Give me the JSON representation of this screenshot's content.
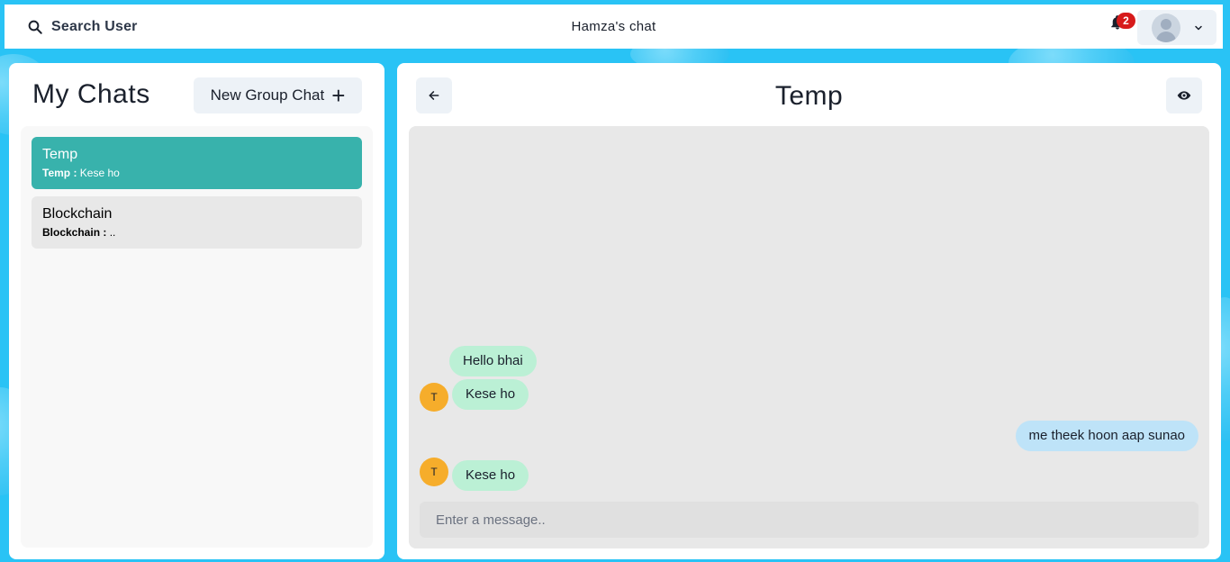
{
  "colors": {
    "background": "#29c3f5",
    "active_chat": "#38b2ac",
    "incoming_bubble": "#bbf0d5",
    "outgoing_bubble": "#bee3f8",
    "sender_avatar": "#f6ad2b",
    "notification_badge": "#d71b1b"
  },
  "topbar": {
    "search_label": "Search User",
    "app_title": "Hamza's chat",
    "notification_count": "2"
  },
  "sidebar": {
    "title": "My Chats",
    "new_group_label": "New Group Chat",
    "new_group_icon": "+",
    "chats": [
      {
        "name": "Temp",
        "preview_sender": "Temp :",
        "preview_text": " Kese ho",
        "active": true
      },
      {
        "name": "Blockchain",
        "preview_sender": "Blockchain :",
        "preview_text": " ..",
        "active": false
      }
    ]
  },
  "conversation": {
    "title": "Temp",
    "messages": [
      {
        "text": "Hello bhai",
        "direction": "in",
        "avatar": ""
      },
      {
        "text": "Kese ho",
        "direction": "in",
        "avatar": "T"
      },
      {
        "text": "me theek hoon aap sunao",
        "direction": "out",
        "avatar": ""
      },
      {
        "text": "Kese ho",
        "direction": "in",
        "avatar": "T"
      }
    ],
    "input_placeholder": "Enter a message.."
  }
}
